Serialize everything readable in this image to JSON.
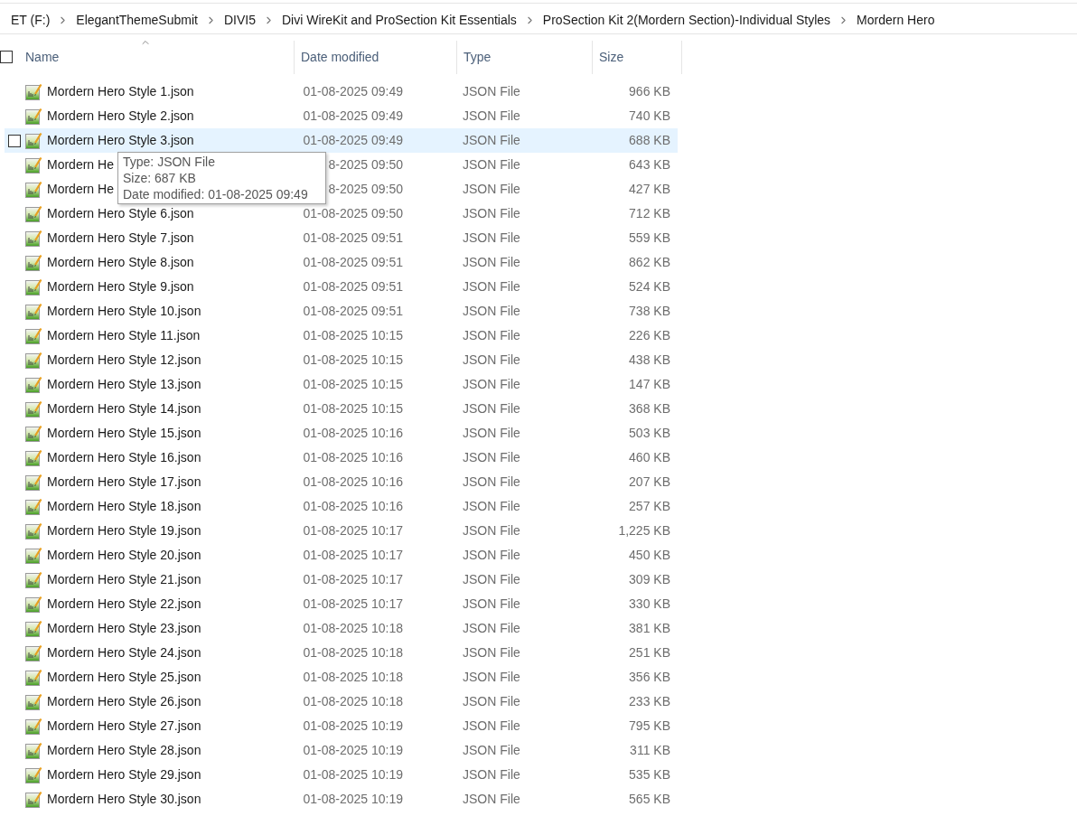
{
  "breadcrumb": [
    "ET (F:)",
    "ElegantThemeSubmit",
    "DIVI5",
    "Divi WireKit and ProSection Kit Essentials",
    "ProSection Kit 2(Mordern Section)-Individual Styles",
    "Mordern Hero"
  ],
  "select_all": {
    "checked": false
  },
  "columns": [
    "Name",
    "Date modified",
    "Type",
    "Size"
  ],
  "rows": [
    {
      "name": "Mordern Hero Style 1.json",
      "date": "01-08-2025 09:49",
      "type": "JSON File",
      "size": "966 KB",
      "selected": false
    },
    {
      "name": "Mordern Hero Style 2.json",
      "date": "01-08-2025 09:49",
      "type": "JSON File",
      "size": "740 KB",
      "selected": false
    },
    {
      "name": "Mordern Hero Style 3.json",
      "date": "01-08-2025 09:49",
      "type": "JSON File",
      "size": "688 KB",
      "selected": true
    },
    {
      "name": "Mordern He",
      "date": "8-2025 09:50",
      "type": "JSON File",
      "size": "643 KB",
      "selected": false
    },
    {
      "name": "Mordern He",
      "date": "8-2025 09:50",
      "type": "JSON File",
      "size": "427 KB",
      "selected": false
    },
    {
      "name": "Mordern Hero Style 6.json",
      "date": "01-08-2025 09:50",
      "type": "JSON File",
      "size": "712 KB",
      "selected": false
    },
    {
      "name": "Mordern Hero Style 7.json",
      "date": "01-08-2025 09:51",
      "type": "JSON File",
      "size": "559 KB",
      "selected": false
    },
    {
      "name": "Mordern Hero Style 8.json",
      "date": "01-08-2025 09:51",
      "type": "JSON File",
      "size": "862 KB",
      "selected": false
    },
    {
      "name": "Mordern Hero Style 9.json",
      "date": "01-08-2025 09:51",
      "type": "JSON File",
      "size": "524 KB",
      "selected": false
    },
    {
      "name": "Mordern Hero Style 10.json",
      "date": "01-08-2025 09:51",
      "type": "JSON File",
      "size": "738 KB",
      "selected": false
    },
    {
      "name": "Mordern Hero Style 11.json",
      "date": "01-08-2025 10:15",
      "type": "JSON File",
      "size": "226 KB",
      "selected": false
    },
    {
      "name": "Mordern Hero Style 12.json",
      "date": "01-08-2025 10:15",
      "type": "JSON File",
      "size": "438 KB",
      "selected": false
    },
    {
      "name": "Mordern Hero Style 13.json",
      "date": "01-08-2025 10:15",
      "type": "JSON File",
      "size": "147 KB",
      "selected": false
    },
    {
      "name": "Mordern Hero Style 14.json",
      "date": "01-08-2025 10:15",
      "type": "JSON File",
      "size": "368 KB",
      "selected": false
    },
    {
      "name": "Mordern Hero Style 15.json",
      "date": "01-08-2025 10:16",
      "type": "JSON File",
      "size": "503 KB",
      "selected": false
    },
    {
      "name": "Mordern Hero Style 16.json",
      "date": "01-08-2025 10:16",
      "type": "JSON File",
      "size": "460 KB",
      "selected": false
    },
    {
      "name": "Mordern Hero Style 17.json",
      "date": "01-08-2025 10:16",
      "type": "JSON File",
      "size": "207 KB",
      "selected": false
    },
    {
      "name": "Mordern Hero Style 18.json",
      "date": "01-08-2025 10:16",
      "type": "JSON File",
      "size": "257 KB",
      "selected": false
    },
    {
      "name": "Mordern Hero Style 19.json",
      "date": "01-08-2025 10:17",
      "type": "JSON File",
      "size": "1,225 KB",
      "selected": false
    },
    {
      "name": "Mordern Hero Style 20.json",
      "date": "01-08-2025 10:17",
      "type": "JSON File",
      "size": "450 KB",
      "selected": false
    },
    {
      "name": "Mordern Hero Style 21.json",
      "date": "01-08-2025 10:17",
      "type": "JSON File",
      "size": "309 KB",
      "selected": false
    },
    {
      "name": "Mordern Hero Style 22.json",
      "date": "01-08-2025 10:17",
      "type": "JSON File",
      "size": "330 KB",
      "selected": false
    },
    {
      "name": "Mordern Hero Style 23.json",
      "date": "01-08-2025 10:18",
      "type": "JSON File",
      "size": "381 KB",
      "selected": false
    },
    {
      "name": "Mordern Hero Style 24.json",
      "date": "01-08-2025 10:18",
      "type": "JSON File",
      "size": "251 KB",
      "selected": false
    },
    {
      "name": "Mordern Hero Style 25.json",
      "date": "01-08-2025 10:18",
      "type": "JSON File",
      "size": "356 KB",
      "selected": false
    },
    {
      "name": "Mordern Hero Style 26.json",
      "date": "01-08-2025 10:18",
      "type": "JSON File",
      "size": "233 KB",
      "selected": false
    },
    {
      "name": "Mordern Hero Style 27.json",
      "date": "01-08-2025 10:19",
      "type": "JSON File",
      "size": "795 KB",
      "selected": false
    },
    {
      "name": "Mordern Hero Style 28.json",
      "date": "01-08-2025 10:19",
      "type": "JSON File",
      "size": "311 KB",
      "selected": false
    },
    {
      "name": "Mordern Hero Style 29.json",
      "date": "01-08-2025 10:19",
      "type": "JSON File",
      "size": "535 KB",
      "selected": false
    },
    {
      "name": "Mordern Hero Style 30.json",
      "date": "01-08-2025 10:19",
      "type": "JSON File",
      "size": "565 KB",
      "selected": false
    }
  ],
  "tooltip": [
    "Type: JSON File",
    "Size: 687 KB",
    "Date modified: 01-08-2025 09:49"
  ]
}
